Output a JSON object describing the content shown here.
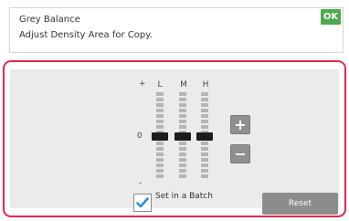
{
  "header": {
    "line1": "Grey Balance",
    "line2": "Adjust Density Area for Copy.",
    "ok_label": "OK"
  },
  "scale": {
    "plus": "+",
    "zero": "0",
    "minus": "-"
  },
  "columns": [
    {
      "label": "L",
      "level": 0
    },
    {
      "label": "M",
      "level": 0
    },
    {
      "label": "H",
      "level": 0
    }
  ],
  "buttons": {
    "increase": "+",
    "decrease": "−",
    "reset": "Reset"
  },
  "batch": {
    "label": "Set in a Batch",
    "checked": true
  },
  "colors": {
    "ok_green": "#4ea84f",
    "panel_border": "#e0294a",
    "check_blue": "#2a8fd6"
  },
  "icons": {
    "check": "checkmark-icon"
  }
}
